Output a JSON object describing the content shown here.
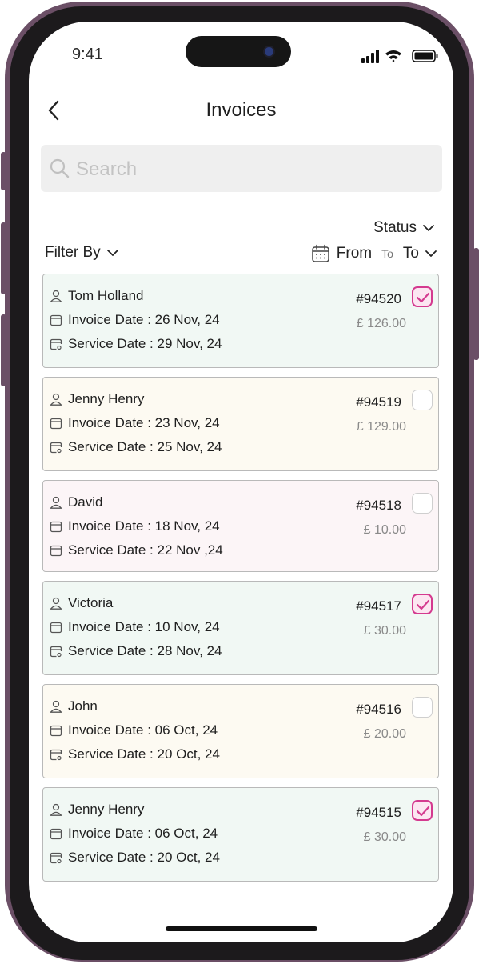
{
  "status_bar": {
    "time": "9:41"
  },
  "header": {
    "title": "Invoices"
  },
  "search": {
    "placeholder": "Search"
  },
  "filters": {
    "status_label": "Status",
    "filter_by_label": "Filter By",
    "from_label": "From",
    "to_small": "To",
    "to_label": "To"
  },
  "colors": {
    "accent": "#d43a8f",
    "card_green": "#f1f8f4",
    "card_cream": "#fdfaf2",
    "card_pink": "#fcf5f7"
  },
  "invoices": [
    {
      "name": "Tom Holland",
      "invoice_date": "Invoice Date : 26 Nov, 24",
      "service_date": "Service Date : 29 Nov, 24",
      "number": "#94520",
      "amount": "£ 126.00",
      "checked": true,
      "color": "green"
    },
    {
      "name": "Jenny Henry",
      "invoice_date": "Invoice Date : 23 Nov, 24",
      "service_date": "Service Date : 25 Nov, 24",
      "number": "#94519",
      "amount": "£ 129.00",
      "checked": false,
      "color": "cream"
    },
    {
      "name": "David",
      "invoice_date": "Invoice Date : 18 Nov, 24",
      "service_date": "Service Date : 22 Nov ,24",
      "number": "#94518",
      "amount": "£ 10.00",
      "checked": false,
      "color": "pink"
    },
    {
      "name": "Victoria",
      "invoice_date": "Invoice Date : 10 Nov, 24",
      "service_date": "Service Date : 28 Nov, 24",
      "number": "#94517",
      "amount": "£ 30.00",
      "checked": true,
      "color": "green"
    },
    {
      "name": "John",
      "invoice_date": "Invoice Date : 06 Oct, 24",
      "service_date": "Service Date : 20 Oct, 24",
      "number": "#94516",
      "amount": "£ 20.00",
      "checked": false,
      "color": "cream"
    },
    {
      "name": "Jenny Henry",
      "invoice_date": "Invoice Date : 06 Oct, 24",
      "service_date": "Service Date : 20 Oct, 24",
      "number": "#94515",
      "amount": "£ 30.00",
      "checked": true,
      "color": "green"
    }
  ]
}
